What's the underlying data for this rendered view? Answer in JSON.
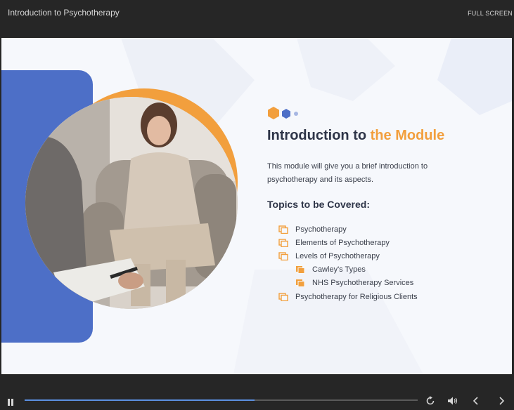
{
  "header": {
    "course_title": "Introduction to Psychotherapy",
    "fullscreen_label": "FULL SCREEN"
  },
  "slide": {
    "heading_plain": "Introduction to ",
    "heading_accent": "the Module",
    "description": "This module will give you a brief introduction to psychotherapy and its aspects.",
    "topics_title": "Topics to be Covered:",
    "topics": [
      "Psychotherapy",
      "Elements of Psychotherapy",
      "Levels of Psychotherapy",
      "Cawley's Types",
      "NHS Psychotherapy Services",
      "Psychotherapy for Religious Clients"
    ],
    "image": "therapy-session-photo"
  },
  "player": {
    "progress_fraction": 0.585,
    "icons": [
      "pause-icon",
      "replay-icon",
      "volume-icon",
      "previous-icon",
      "next-icon"
    ]
  },
  "colors": {
    "accent_orange": "#f29f3d",
    "accent_blue": "#4d6fc7",
    "heading": "#2e3548",
    "bar": "#262626",
    "progress": "#5b8fe0"
  }
}
